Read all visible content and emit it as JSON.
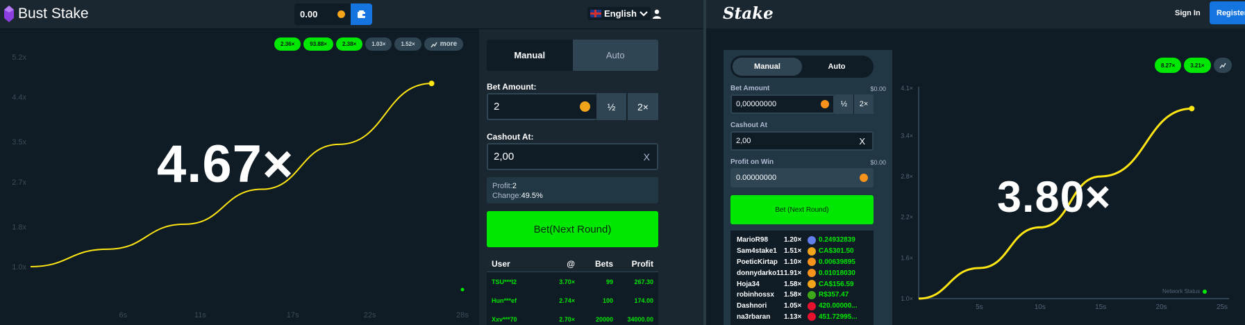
{
  "left_app": {
    "brand": "Bust Stake",
    "balance": "0.00",
    "language": "English",
    "colors": {
      "accent_green": "#00e701",
      "curve": "#ffe512",
      "brand_blue": "#1475e1"
    },
    "history": [
      {
        "label": "2.36×",
        "style": "green"
      },
      {
        "label": "93.88×",
        "style": "green"
      },
      {
        "label": "2.38×",
        "style": "green"
      },
      {
        "label": "1.03×",
        "style": "gray"
      },
      {
        "label": "1.52×",
        "style": "gray"
      }
    ],
    "history_more": "more",
    "multiplier": "4.67×",
    "panel": {
      "tab_manual": "Manual",
      "tab_auto": "Auto",
      "bet_amount_label": "Bet Amount:",
      "bet_amount_value": "2",
      "half_label": "½",
      "double_label": "2×",
      "cashout_label": "Cashout At:",
      "cashout_value": "2,00",
      "clear_label": "X",
      "profit_label": "Profit:",
      "profit_value": "2",
      "change_label": "Change:",
      "change_value": "49.5%",
      "bet_button": "Bet(Next Round)"
    },
    "table": {
      "headers": {
        "user": "User",
        "at": "@",
        "bets": "Bets",
        "profit": "Profit"
      },
      "rows": [
        {
          "user": "TSU***I2",
          "at": "3.70×",
          "bets": "99",
          "profit": "267.30"
        },
        {
          "user": "Hun***ef",
          "at": "2.74×",
          "bets": "100",
          "profit": "174.00"
        },
        {
          "user": "Xxv***70",
          "at": "2.70×",
          "bets": "20000",
          "profit": "34000.00"
        }
      ]
    }
  },
  "left_chart": {
    "type": "line",
    "yticks": [
      "1.0x",
      "1.8x",
      "2.7x",
      "3.5x",
      "4.4x",
      "5.2x"
    ],
    "xticks": [
      "6s",
      "11s",
      "17s",
      "22s",
      "28s"
    ],
    "series": [
      {
        "x": [
          0,
          5,
          10,
          15,
          20,
          26
        ],
        "values": [
          1.0,
          1.35,
          1.85,
          2.55,
          3.45,
          4.67
        ]
      }
    ]
  },
  "right_app": {
    "brand": "Stake",
    "signin": "Sign In",
    "register": "Register",
    "tab_manual": "Manual",
    "tab_auto": "Auto",
    "bet_amount_label": "Bet Amount",
    "bet_amount_usd": "$0.00",
    "bet_amount_value": "0,00000000",
    "half_label": "½",
    "double_label": "2×",
    "cashout_label": "Cashout At",
    "cashout_value": "2,00",
    "clear_label": "X",
    "profit_label": "Profit on Win",
    "profit_usd": "$0.00",
    "profit_value": "0.00000000",
    "bet_button": "Bet (Next Round)",
    "multiplier": "3.80×",
    "history": [
      "8.27×",
      "3.21×"
    ],
    "network_status": "Network Status",
    "players": [
      {
        "name": "MarioR98",
        "mult": "1.20×",
        "amount": "0.24932839",
        "icon_color": "#627eea",
        "icon": "eth-icon"
      },
      {
        "name": "Sam4stake1",
        "mult": "1.51×",
        "amount": "CA$301.50",
        "icon_color": "#f2a41a",
        "icon": "dollar-icon"
      },
      {
        "name": "PoeticKirtap",
        "mult": "1.10×",
        "amount": "0.00639895",
        "icon_color": "#f7931a",
        "icon": "btc-icon"
      },
      {
        "name": "donnydarko11",
        "mult": "1.91×",
        "amount": "0.01018030",
        "icon_color": "#f7931a",
        "icon": "btc-icon"
      },
      {
        "name": "Hoja34",
        "mult": "1.58×",
        "amount": "CA$156.59",
        "icon_color": "#f2a41a",
        "icon": "dollar-icon"
      },
      {
        "name": "robinhossx",
        "mult": "1.58×",
        "amount": "R$357.47",
        "icon_color": "#3ca81a",
        "icon": "real-icon"
      },
      {
        "name": "Dashnori",
        "mult": "1.05×",
        "amount": "420.00000...",
        "icon_color": "#e8112d",
        "icon": "trx-icon"
      },
      {
        "name": "na3rbaran",
        "mult": "1.13×",
        "amount": "451.72995...",
        "icon_color": "#e8112d",
        "icon": "trx-icon"
      }
    ]
  },
  "right_chart": {
    "type": "line",
    "yticks": [
      "1.0×",
      "1.6×",
      "2.2×",
      "2.8×",
      "3.4×",
      "4.1×"
    ],
    "xticks": [
      "5s",
      "10s",
      "15s",
      "20s",
      "25s"
    ],
    "series": [
      {
        "x": [
          0,
          5,
          10,
          15,
          22.5
        ],
        "values": [
          1.0,
          1.45,
          2.05,
          2.8,
          3.8
        ]
      }
    ]
  }
}
